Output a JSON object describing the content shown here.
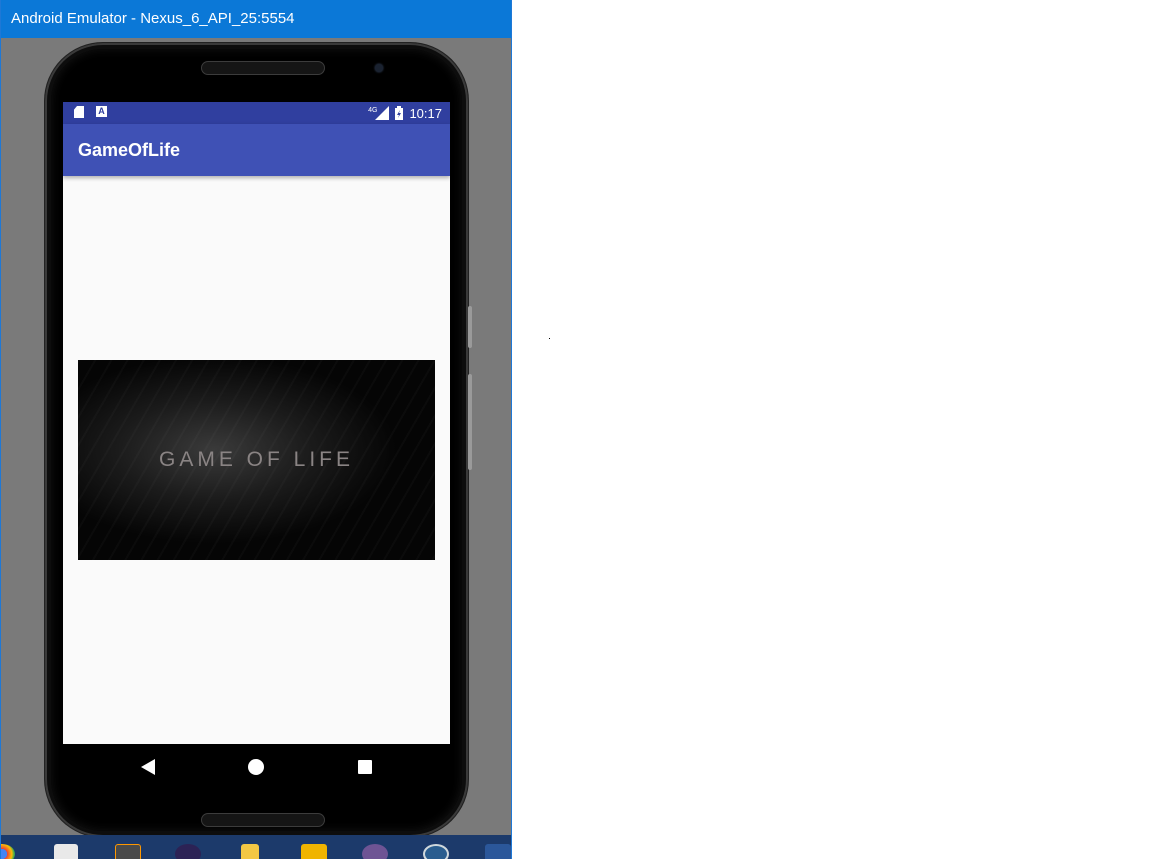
{
  "window": {
    "title": "Android Emulator - Nexus_6_API_25:5554"
  },
  "statusbar": {
    "network_label": "4G",
    "time": "10:17",
    "left_icons": [
      "sd-card-icon",
      "a-notification-icon"
    ],
    "right_icons": [
      "signal-icon",
      "battery-icon"
    ]
  },
  "app": {
    "title": "GameOfLife",
    "banner_text": "GAME OF LIFE"
  },
  "navbar": {
    "buttons": [
      "back",
      "home",
      "recents"
    ]
  },
  "taskbar": {
    "icons": [
      "chrome-icon",
      "store-icon",
      "sublime-icon",
      "eclipse-icon",
      "file-explorer-icon",
      "search-app-icon",
      "github-icon",
      "settings-app-icon",
      "word-icon"
    ]
  },
  "colors": {
    "titlebar": "#0b78d7",
    "statusbar": "#303f9f",
    "appbar": "#3f51b5",
    "screen_bg": "#fafafa",
    "banner_text": "#8a8484"
  }
}
